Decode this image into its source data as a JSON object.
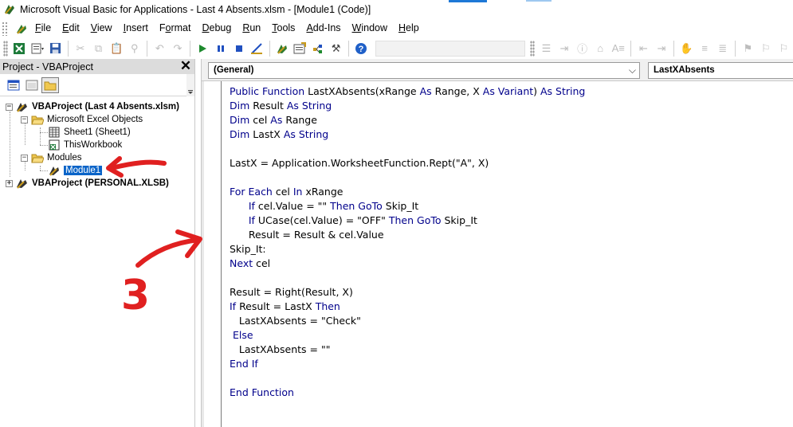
{
  "window": {
    "title": "Microsoft Visual Basic for Applications - Last 4 Absents.xlsm - [Module1 (Code)]"
  },
  "menu": [
    {
      "pre": "",
      "u": "F",
      "post": "ile"
    },
    {
      "pre": "",
      "u": "E",
      "post": "dit"
    },
    {
      "pre": "",
      "u": "V",
      "post": "iew"
    },
    {
      "pre": "",
      "u": "I",
      "post": "nsert"
    },
    {
      "pre": "F",
      "u": "o",
      "post": "rmat"
    },
    {
      "pre": "",
      "u": "D",
      "post": "ebug"
    },
    {
      "pre": "",
      "u": "R",
      "post": "un"
    },
    {
      "pre": "",
      "u": "T",
      "post": "ools"
    },
    {
      "pre": "",
      "u": "A",
      "post": "dd-Ins"
    },
    {
      "pre": "",
      "u": "W",
      "post": "indow"
    },
    {
      "pre": "",
      "u": "H",
      "post": "elp"
    }
  ],
  "project_panel": {
    "title": "Project - VBAProject",
    "tree": {
      "project1": "VBAProject (Last 4 Absents.xlsm)",
      "excel_objects": "Microsoft Excel Objects",
      "sheet1": "Sheet1 (Sheet1)",
      "thisworkbook": "ThisWorkbook",
      "modules": "Modules",
      "module1": "Module1",
      "project2": "VBAProject (PERSONAL.XLSB)"
    }
  },
  "code_window": {
    "object_combo": "(General)",
    "procedure_combo": "LastXAbsents",
    "lines": [
      [
        [
          "kw",
          "Public Function "
        ],
        [
          "",
          "LastXAbsents(xRange "
        ],
        [
          "kw",
          "As "
        ],
        [
          "",
          "Range, X "
        ],
        [
          "kw",
          "As Variant"
        ],
        [
          "",
          ") "
        ],
        [
          "kw",
          "As String"
        ]
      ],
      [
        [
          "kw",
          "Dim "
        ],
        [
          "",
          "Result "
        ],
        [
          "kw",
          "As String"
        ]
      ],
      [
        [
          "kw",
          "Dim "
        ],
        [
          "",
          "cel "
        ],
        [
          "kw",
          "As "
        ],
        [
          "",
          "Range"
        ]
      ],
      [
        [
          "kw",
          "Dim "
        ],
        [
          "",
          "LastX "
        ],
        [
          "kw",
          "As String"
        ]
      ],
      [],
      [
        [
          "",
          "LastX = Application.WorksheetFunction.Rept(\"A\", X)"
        ]
      ],
      [],
      [
        [
          "kw",
          "For Each "
        ],
        [
          "",
          "cel "
        ],
        [
          "kw",
          "In "
        ],
        [
          "",
          "xRange"
        ]
      ],
      [
        [
          "",
          "      "
        ],
        [
          "kw",
          "If "
        ],
        [
          "",
          "cel.Value = \"\" "
        ],
        [
          "kw",
          "Then GoTo "
        ],
        [
          "",
          "Skip_It"
        ]
      ],
      [
        [
          "",
          "      "
        ],
        [
          "kw",
          "If "
        ],
        [
          "",
          "UCase(cel.Value) = \"OFF\" "
        ],
        [
          "kw",
          "Then GoTo "
        ],
        [
          "",
          "Skip_It"
        ]
      ],
      [
        [
          "",
          "      Result = Result & cel.Value"
        ]
      ],
      [
        [
          "",
          "Skip_It:"
        ]
      ],
      [
        [
          "kw",
          "Next "
        ],
        [
          "",
          "cel"
        ]
      ],
      [],
      [
        [
          "",
          "Result = Right(Result, X)"
        ]
      ],
      [
        [
          "kw",
          "If "
        ],
        [
          "",
          "Result = LastX "
        ],
        [
          "kw",
          "Then"
        ]
      ],
      [
        [
          "",
          "   LastXAbsents = \"Check\""
        ]
      ],
      [
        [
          "kw",
          " Else"
        ]
      ],
      [
        [
          "",
          "   LastXAbsents = \"\""
        ]
      ],
      [
        [
          "kw",
          "End If"
        ]
      ],
      [],
      [
        [
          "kw",
          "End Function"
        ]
      ]
    ]
  },
  "annotation": {
    "step_number": "3",
    "color": "#e02020"
  },
  "colors": {
    "keyword": "#00008b",
    "selection": "#0a64c8",
    "panel_title_bg": "#dcdcdc"
  }
}
